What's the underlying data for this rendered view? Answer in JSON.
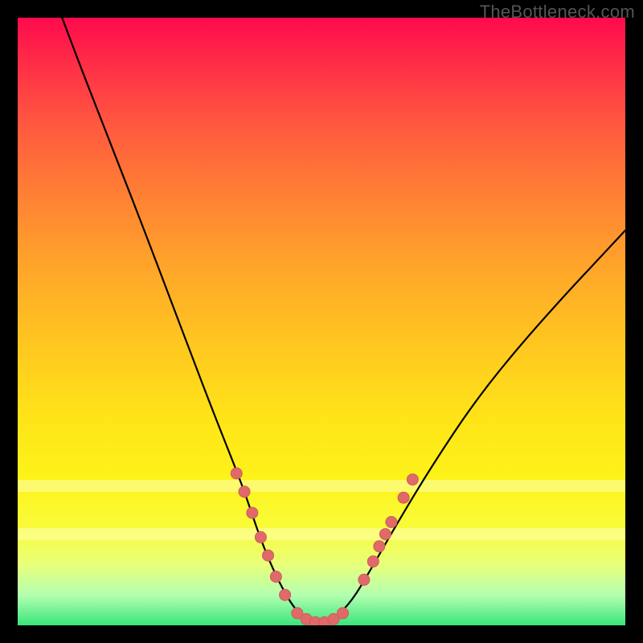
{
  "watermark": "TheBottleneck.com",
  "colors": {
    "frame_bg_top": "#ff0a4c",
    "frame_bg_bottom": "#39e57c",
    "curve": "#000000",
    "marker_fill": "#e06a6a",
    "marker_stroke": "#cf5a5a",
    "pale_band": "#ffffb0"
  },
  "chart_data": {
    "type": "line",
    "title": "",
    "xlabel": "",
    "ylabel": "",
    "xlim": [
      0,
      100
    ],
    "ylim": [
      0,
      100
    ],
    "grid": false,
    "legend": false,
    "notes": "V-shaped bottleneck curve. y≈0 is optimal (green), y≈100 is worst (red). Minimum around x≈46–52.",
    "x": [
      0,
      8,
      15,
      22,
      28,
      33,
      37,
      40,
      43,
      46,
      49,
      52,
      55,
      58,
      62,
      68,
      76,
      86,
      100
    ],
    "y": [
      120,
      98,
      80,
      62,
      46,
      33,
      23,
      14,
      7,
      2,
      0,
      1,
      4,
      9,
      16,
      26,
      38,
      50,
      65
    ],
    "markers": [
      {
        "x": 36.0,
        "y": 25.0
      },
      {
        "x": 37.3,
        "y": 22.0
      },
      {
        "x": 38.6,
        "y": 18.5
      },
      {
        "x": 40.0,
        "y": 14.5
      },
      {
        "x": 41.2,
        "y": 11.5
      },
      {
        "x": 42.5,
        "y": 8.0
      },
      {
        "x": 44.0,
        "y": 5.0
      },
      {
        "x": 46.0,
        "y": 2.0
      },
      {
        "x": 47.5,
        "y": 1.0
      },
      {
        "x": 49.0,
        "y": 0.5
      },
      {
        "x": 50.5,
        "y": 0.5
      },
      {
        "x": 52.0,
        "y": 1.0
      },
      {
        "x": 53.5,
        "y": 2.0
      },
      {
        "x": 57.0,
        "y": 7.5
      },
      {
        "x": 58.5,
        "y": 10.5
      },
      {
        "x": 59.5,
        "y": 13.0
      },
      {
        "x": 60.5,
        "y": 15.0
      },
      {
        "x": 61.5,
        "y": 17.0
      },
      {
        "x": 63.5,
        "y": 21.0
      },
      {
        "x": 65.0,
        "y": 24.0
      }
    ],
    "pale_bands_y": [
      {
        "from": 22,
        "to": 24
      },
      {
        "from": 14,
        "to": 16
      }
    ]
  }
}
